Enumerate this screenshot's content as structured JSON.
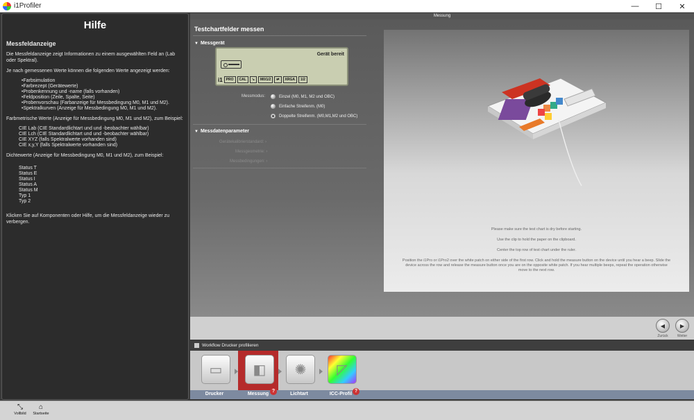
{
  "window": {
    "title": "i1Profiler",
    "minimize": "—",
    "maximize": "☐",
    "close": "✕"
  },
  "help": {
    "title": "Hilfe",
    "subtitle": "Messfeldanzeige",
    "p1": "Die Messfeldanzeige zeigt Informationen zu einem ausgewählten Feld an (Lab oder Spektral).",
    "p2": "Je nach gemessenen Werte können die folgenden Werte angezeigt werden:",
    "list1": [
      "•Farbsimulation",
      "•Farbrezept (Gerätewerte)",
      "•Probenkennung und -name (falls vorhanden)",
      "•Feldposition (Zeile, Spalte, Seite)",
      "•Probenvorschau (Farbanzeige für Messbedingung M0, M1 und M2).",
      "•Spektralkurven (Anzeige für Messbedingung M0, M1 und M2)."
    ],
    "p3": "Farbmetrische Werte (Anzeige für Messbedingung M0, M1 und M2), zum Beispiel:",
    "list2": [
      "CIE Lab (CIE Standardlichtart und und -beobachter wählbar)",
      "CIE Lch (CIE Standardlichtart und und -beobachter wählbar)",
      "CIE XYZ (falls Spektralwerte vorhanden sind)",
      "CIE x,y,Y (falls Spektralwerte vorhanden sind)"
    ],
    "p4": "Dichtewerte (Anzeige für Messbedingung M0, M1 und M2), zum Beispiel:",
    "list3": [
      "Status T",
      "Status E",
      "Status I",
      "Status A",
      "Status M",
      "Typ 1",
      "Typ 2"
    ],
    "p5": "Klicken Sie auf Komponenten oder Hilfe, um die Messfeldanzeige wieder zu verbergen."
  },
  "main": {
    "header": "Messung",
    "title": "Testchartfelder messen",
    "section_device": "Messgerät",
    "lcd": {
      "status": "Gerät bereit",
      "cells": [
        "PRO",
        "CAL",
        "↘",
        "M0/1/2",
        "⇄",
        "XRGA",
        "1/2"
      ],
      "brand": "i1"
    },
    "modes_label": "Messmodus:",
    "modes": [
      "Einzel (M0, M1, M2 und OBC)",
      "Einfache Streifenm. (M0)",
      "Doppelte Streifenm. (M0,M1,M2 und OBC)"
    ],
    "section_params": "Messdatenparameter",
    "params": [
      "Gerätekalibrierstandard:",
      "Messgeometrie:",
      "Messbedingungen:"
    ],
    "instructions": [
      "Please make sure the test chart is dry before starting.",
      "Use the clip to hold the paper on the clipboard.",
      "Center the top row of test chart under the ruler.",
      "Position the i1Pro or i1Pro2 over the white patch on either side of the first row. Click and hold the measure button on the device until you hear a beep. Slide the device across the row and release the measure button once you are on the opposite white patch. If you hear multiple beeps, repeat the operation otherwise move to the next row."
    ]
  },
  "nav": {
    "back": "Zurück",
    "next": "Weiter"
  },
  "workflow": {
    "title": "Workflow Drucker profilieren",
    "steps": [
      "Drucker",
      "Messung",
      "Lichtart",
      "ICC-Profil"
    ]
  },
  "toolbar": {
    "full": "Vollbild",
    "home": "Startseite"
  },
  "colors": {
    "accent": "#b52b2b",
    "panel": "#2c2c2c"
  }
}
